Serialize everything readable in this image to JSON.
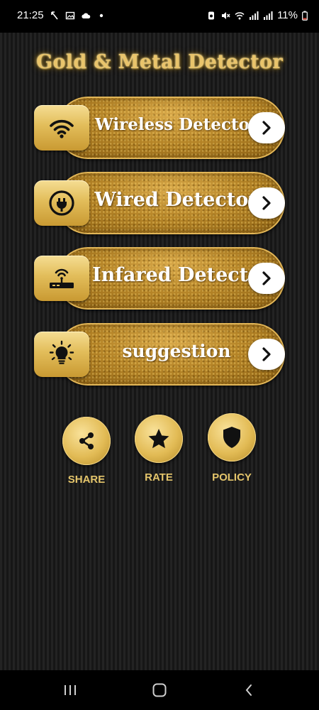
{
  "status_bar": {
    "time": "21:25",
    "battery": "11%",
    "left_icons": [
      "missed-call-icon",
      "gallery-icon",
      "cloud-icon",
      "dot-icon"
    ],
    "right_icons": [
      "alarm-icon",
      "mute-icon",
      "wifi-icon",
      "signal-icon",
      "signal-icon",
      "battery-icon"
    ]
  },
  "app": {
    "title": "Gold & Metal Detector"
  },
  "menu": {
    "items": [
      {
        "label": "Wireless Detector",
        "icon": "wifi-icon"
      },
      {
        "label": "Wired Detector",
        "icon": "plug-icon"
      },
      {
        "label": "Infared Detector",
        "icon": "router-icon"
      },
      {
        "label": "suggestion",
        "icon": "lightbulb-icon"
      }
    ],
    "arrow_icon": "chevron-right-icon"
  },
  "actions": {
    "share": {
      "label": "SHARE",
      "icon": "share-icon"
    },
    "rate": {
      "label": "RATE",
      "icon": "star-icon"
    },
    "policy": {
      "label": "POLICY",
      "icon": "shield-icon"
    }
  },
  "colors": {
    "gold": "#e2bb55",
    "gold_text": "#e4c56b",
    "pill": "#a9791f",
    "background": "#1b1b1b"
  }
}
